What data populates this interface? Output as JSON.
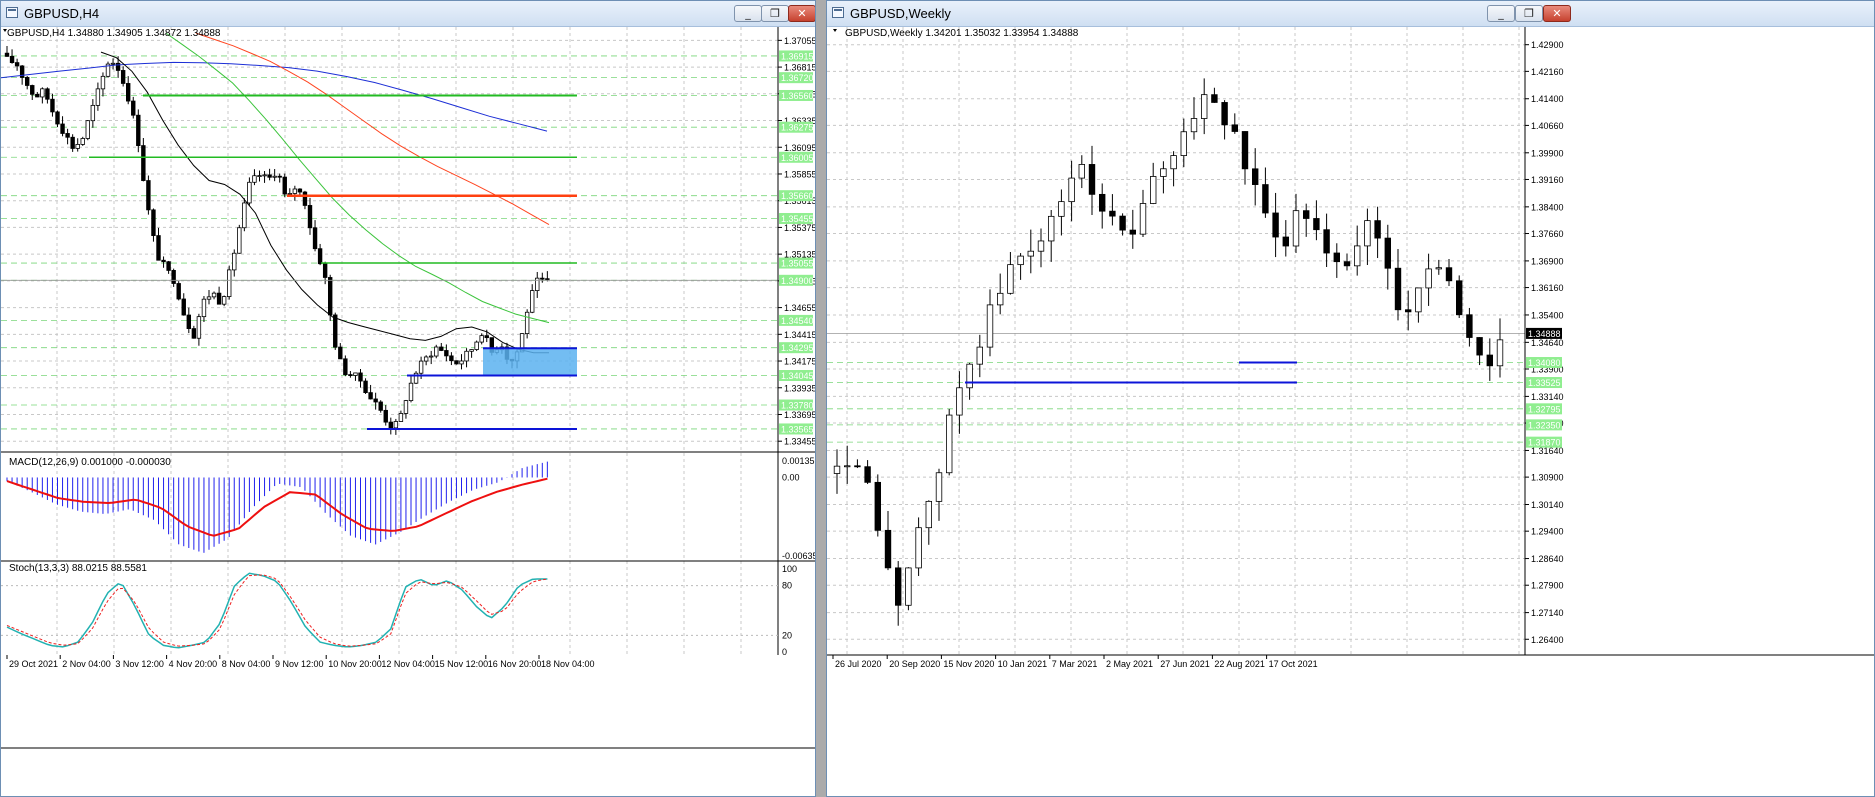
{
  "left_window": {
    "title": "GBPUSD,H4",
    "ohlc_info": "GBPUSD,H4  1.34880 1.34905 1.34872 1.34888",
    "price_ticks": [
      "1.37055",
      "1.36815",
      "1.36575",
      "1.36335",
      "1.36095",
      "1.35855",
      "1.35615",
      "1.35375",
      "1.35135",
      "1.34895",
      "1.34655",
      "1.34415",
      "1.34175",
      "1.33935",
      "1.33695",
      "1.33455"
    ],
    "level_labels": [
      {
        "text": "1.36915",
        "value": 1.36915,
        "color": "#90ee90"
      },
      {
        "text": "1.36720",
        "value": 1.3672,
        "color": "#90ee90"
      },
      {
        "text": "1.36560",
        "value": 1.3656,
        "color": "#90ee90"
      },
      {
        "text": "1.36275",
        "value": 1.36275,
        "color": "#90ee90"
      },
      {
        "text": "1.36005",
        "value": 1.36005,
        "color": "#90ee90"
      },
      {
        "text": "1.35660",
        "value": 1.3566,
        "color": "#90ee90"
      },
      {
        "text": "1.35455",
        "value": 1.35455,
        "color": "#90ee90"
      },
      {
        "text": "1.35055",
        "value": 1.35055,
        "color": "#90ee90"
      },
      {
        "text": "1.34900",
        "value": 1.349,
        "color": "#90ee90"
      },
      {
        "text": "1.34540",
        "value": 1.3454,
        "color": "#90ee90"
      },
      {
        "text": "1.34295",
        "value": 1.34295,
        "color": "#90ee90"
      },
      {
        "text": "1.34045",
        "value": 1.34045,
        "color": "#90ee90"
      },
      {
        "text": "1.33780",
        "value": 1.3378,
        "color": "#90ee90"
      },
      {
        "text": "1.33565",
        "value": 1.33565,
        "color": "#90ee90"
      }
    ],
    "macd_label": "MACD(12,26,9) 0.001000 -0.000030",
    "macd_ticks": [
      "0.00135",
      "0.00",
      "-0.006357"
    ],
    "stoch_label": "Stoch(13,3,3) 88.0215 88.5581",
    "stoch_ticks": [
      "100",
      "80",
      "20",
      "0"
    ],
    "time_labels": [
      "29 Oct 2021",
      "2 Nov 04:00",
      "3 Nov 12:00",
      "4 Nov 20:00",
      "8 Nov 04:00",
      "9 Nov 12:00",
      "10 Nov 20:00",
      "12 Nov 04:00",
      "15 Nov 12:00",
      "16 Nov 20:00",
      "18 Nov 04:00"
    ]
  },
  "right_window": {
    "title": "GBPUSD,Weekly",
    "ohlc_info": "GBPUSD,Weekly  1.34201 1.35032 1.33954 1.34888",
    "price_ticks": [
      "1.42900",
      "1.42160",
      "1.41400",
      "1.40660",
      "1.39900",
      "1.39160",
      "1.38400",
      "1.37660",
      "1.36900",
      "1.36160",
      "1.35400",
      "1.34640",
      "1.33900",
      "1.33140",
      "1.32400",
      "1.31640",
      "1.30900",
      "1.30140",
      "1.29400",
      "1.28640",
      "1.27900",
      "1.27140",
      "1.26400"
    ],
    "current_price": "1.34888",
    "level_labels": [
      {
        "text": "1.34080",
        "value": 1.3408
      },
      {
        "text": "1.33525",
        "value": 1.33525
      },
      {
        "text": "1.32795",
        "value": 1.32795
      },
      {
        "text": "1.32350",
        "value": 1.3235
      },
      {
        "text": "1.31870",
        "value": 1.3187
      }
    ],
    "time_labels": [
      "26 Jul 2020",
      "20 Sep 2020",
      "15 Nov 2020",
      "10 Jan 2021",
      "7 Mar 2021",
      "2 May 2021",
      "27 Jun 2021",
      "22 Aug 2021",
      "17 Oct 2021"
    ]
  },
  "colors": {
    "ma_black": "#000000",
    "ma_blue": "#1d2fd6",
    "ma_red": "#ff4520",
    "ma_green": "#3cc43c",
    "support": "#0c14d8",
    "resist_green": "#22bb22",
    "resist_red": "#ff4010",
    "zone": "#5ab2f0",
    "grid": "#c8c8c8",
    "label_bg": "#90ee90"
  }
}
